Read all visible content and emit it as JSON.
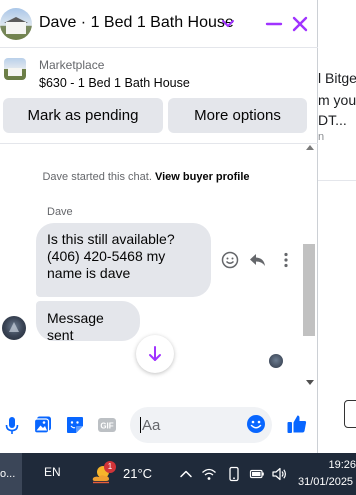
{
  "header": {
    "title": "Dave · 1 Bed 1 Bath House",
    "accent_color": "#a033ff"
  },
  "listing": {
    "source": "Marketplace",
    "title": "$630 - 1 Bed 1 Bath House"
  },
  "actions": {
    "mark_pending": "Mark as pending",
    "more_options": "More options"
  },
  "thread": {
    "started_text": "Dave started this chat.",
    "view_profile": "View buyer profile",
    "sender_name": "Dave",
    "messages": [
      "Is this still available? (406) 420-5468  my name is dave",
      "Message sent"
    ]
  },
  "composer": {
    "placeholder": "Aa"
  },
  "background_page": {
    "line1": "l Bitge",
    "line2": "m you",
    "line3": "DT...",
    "line4": "n"
  },
  "taskbar": {
    "app_label": "o...",
    "language": "EN",
    "weather_badge": "1",
    "temperature": "21°C",
    "time": "19:26",
    "date": "31/01/2025"
  }
}
